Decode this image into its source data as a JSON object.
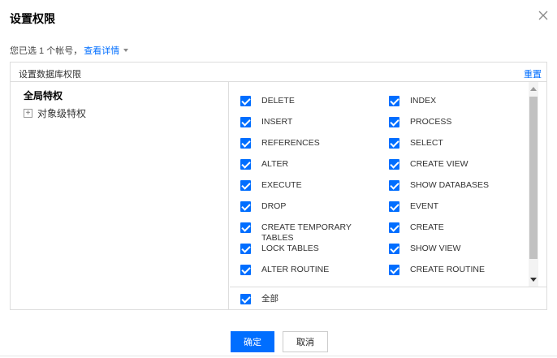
{
  "dialog": {
    "title": "设置权限",
    "subline_text": "您已选 1 个帐号，",
    "view_details": "查看详情"
  },
  "panel": {
    "header_label": "设置数据库权限",
    "reset_label": "重置"
  },
  "tree": {
    "global": "全局特权",
    "object_level": "对象级特权"
  },
  "privileges": {
    "left": [
      "DELETE",
      "INSERT",
      "REFERENCES",
      "ALTER",
      "EXECUTE",
      "DROP",
      "CREATE TEMPORARY TABLES",
      "LOCK TABLES",
      "ALTER ROUTINE"
    ],
    "right": [
      "INDEX",
      "PROCESS",
      "SELECT",
      "CREATE VIEW",
      "SHOW DATABASES",
      "EVENT",
      "CREATE",
      "SHOW VIEW",
      "CREATE ROUTINE"
    ]
  },
  "select_all_label": "全部",
  "buttons": {
    "ok": "确定",
    "cancel": "取消"
  },
  "colors": {
    "accent": "#006eff"
  }
}
